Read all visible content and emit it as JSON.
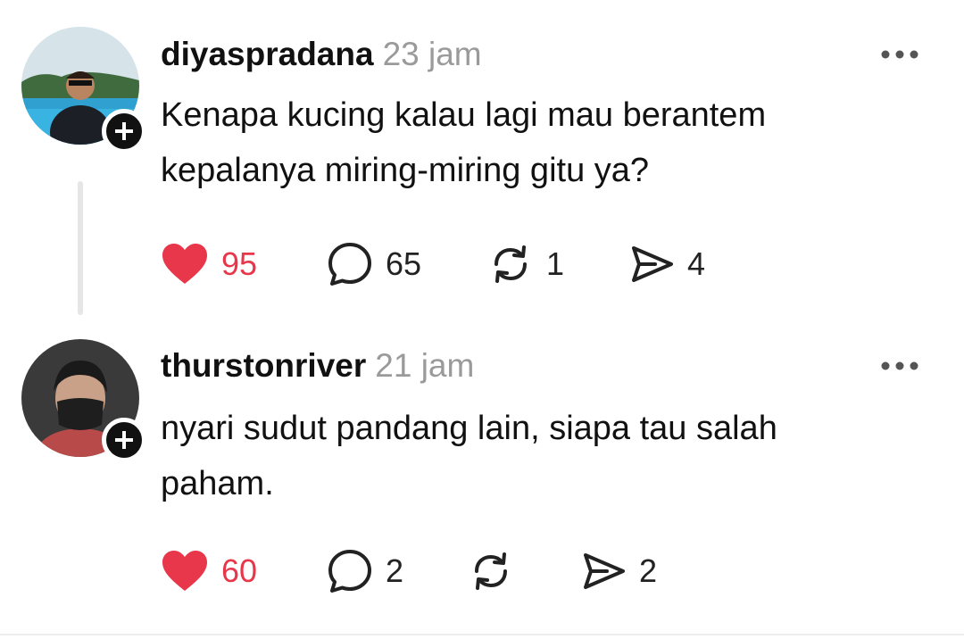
{
  "posts": [
    {
      "username": "diyaspradana",
      "time": "23 jam",
      "text": "Kenapa kucing kalau lagi mau berantem kepalanya miring-miring gitu ya?",
      "likes": "95",
      "comments": "65",
      "reposts": "1",
      "shares": "4",
      "liked": true
    },
    {
      "username": "thurstonriver",
      "time": "21 jam",
      "text": "nyari sudut pandang lain, siapa tau salah paham.",
      "likes": "60",
      "comments": "2",
      "reposts": "",
      "shares": "2",
      "liked": true
    }
  ],
  "colors": {
    "like": "#e8364a",
    "muted": "#9a9a9a",
    "text": "#111111"
  },
  "icons": [
    "heart-icon",
    "comment-icon",
    "repost-icon",
    "share-icon",
    "more-icon",
    "plus-icon"
  ]
}
